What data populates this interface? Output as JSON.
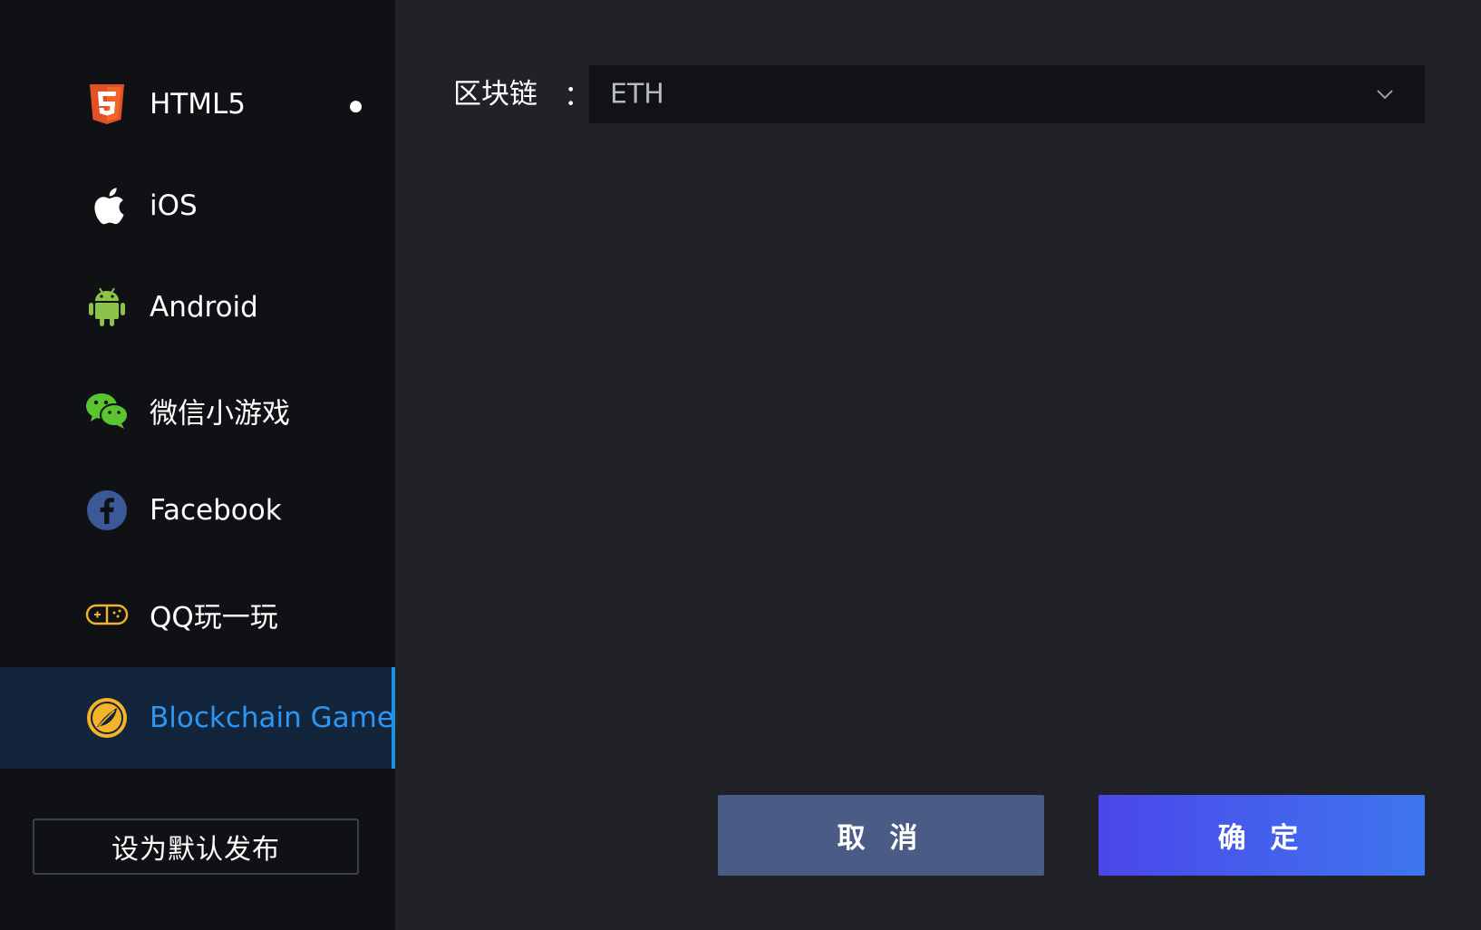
{
  "sidebar": {
    "items": [
      {
        "label": "HTML5",
        "icon": "html5-icon",
        "selected_dot": true
      },
      {
        "label": "iOS",
        "icon": "apple-icon"
      },
      {
        "label": "Android",
        "icon": "android-icon"
      },
      {
        "label": "微信小游戏",
        "icon": "wechat-icon"
      },
      {
        "label": "Facebook",
        "icon": "facebook-icon"
      },
      {
        "label": "QQ玩一玩",
        "icon": "gamepad-icon"
      },
      {
        "label": "Blockchain Game",
        "icon": "blockchain-icon",
        "active": true
      }
    ],
    "default_button_label": "设为默认发布"
  },
  "form": {
    "chain_label": "区块链",
    "colon": "：",
    "chain_value": "ETH"
  },
  "actions": {
    "cancel_label": "取 消",
    "confirm_label": "确 定"
  },
  "colors": {
    "active_accent": "#1f8ee9",
    "confirm_gradient_start": "#4b47ea",
    "confirm_gradient_end": "#3e76ee",
    "cancel_bg": "#4a5c86"
  }
}
